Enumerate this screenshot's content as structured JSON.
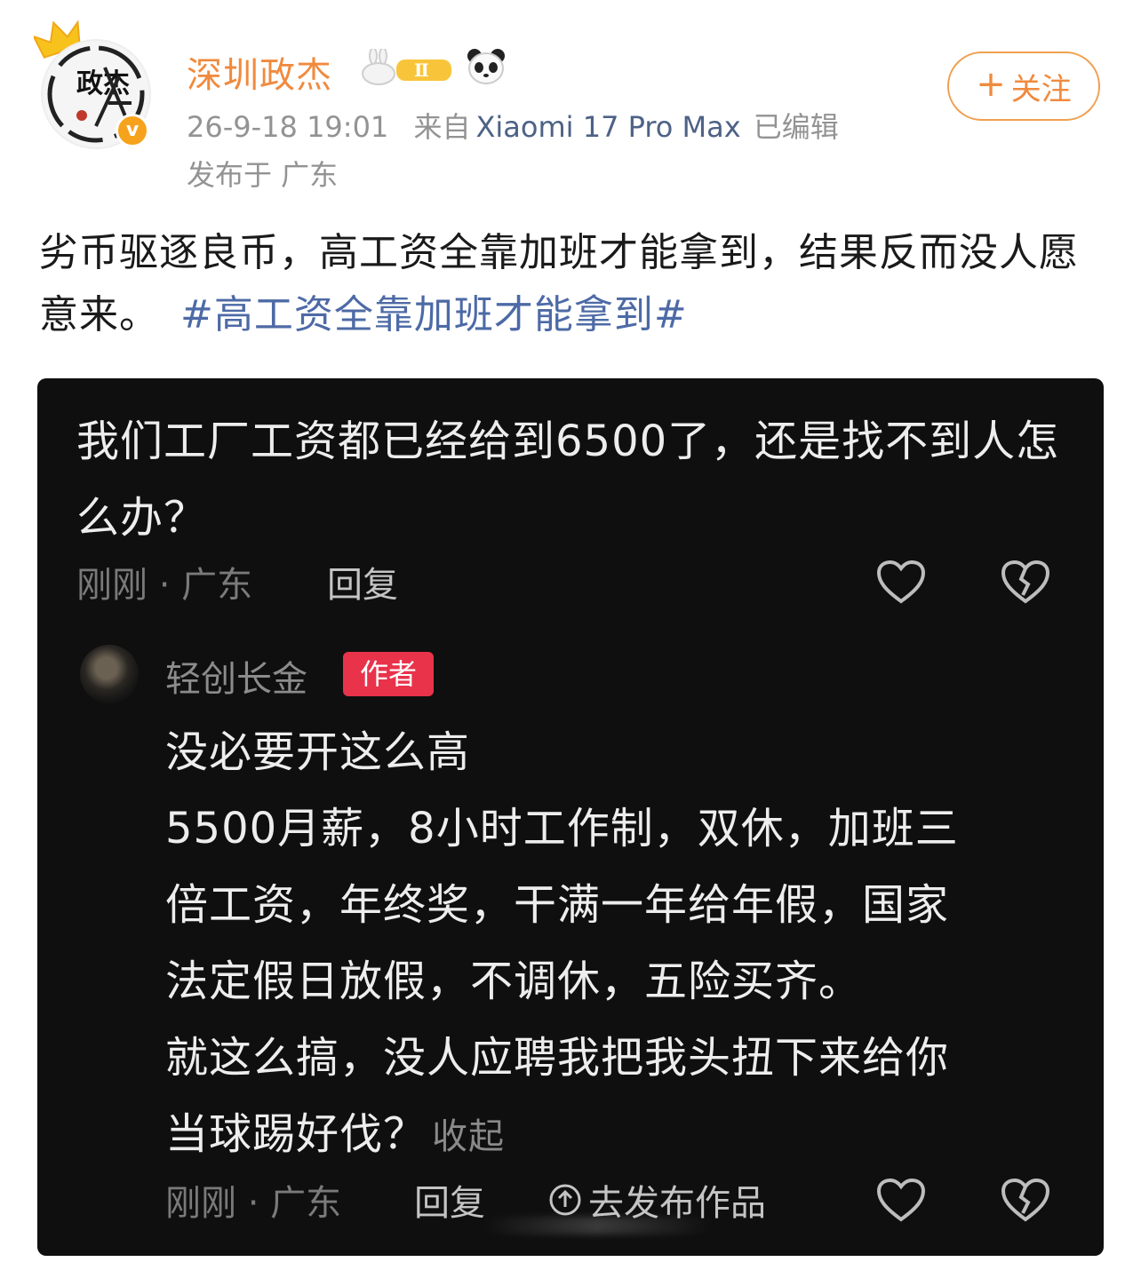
{
  "post": {
    "username": "深圳政杰",
    "avatar_text": "政杰",
    "level_badge": "Ⅱ",
    "timestamp": "26-9-18 19:01",
    "source_prefix": "来自",
    "device": "Xiaomi 17 Pro Max",
    "edited": "已编辑",
    "location": "发布于 广东",
    "follow_label": "关注",
    "text": "劣币驱逐良币，高工资全靠加班才能拿到，结果反而没人愿意来。",
    "topic": "#高工资全靠加班才能拿到#"
  },
  "screenshot": {
    "question": {
      "text": "我们工厂工资都已经给到6500了，还是找不到人怎么办？",
      "meta": "刚刚 · 广东",
      "reply_label": "回复"
    },
    "reply": {
      "name": "轻创长金",
      "badge": "作者",
      "lines": [
        "没必要开这么高",
        "5500月薪，8小时工作制，双休，加班三",
        "倍工资，年终奖，干满一年给年假，国家",
        "法定假日放假，不调休，五险买齐。",
        "就这么搞，没人应聘我把我头扭下来给你",
        "当球踢好伐？"
      ],
      "collapse_label": "收起",
      "meta": "刚刚 · 广东",
      "reply_label": "回复",
      "publish_label": "去发布作品"
    }
  },
  "colors": {
    "username": "#f08a3e",
    "topic": "#4d6aa6",
    "author_badge": "#e8334b",
    "verified": "#f7a21c"
  }
}
